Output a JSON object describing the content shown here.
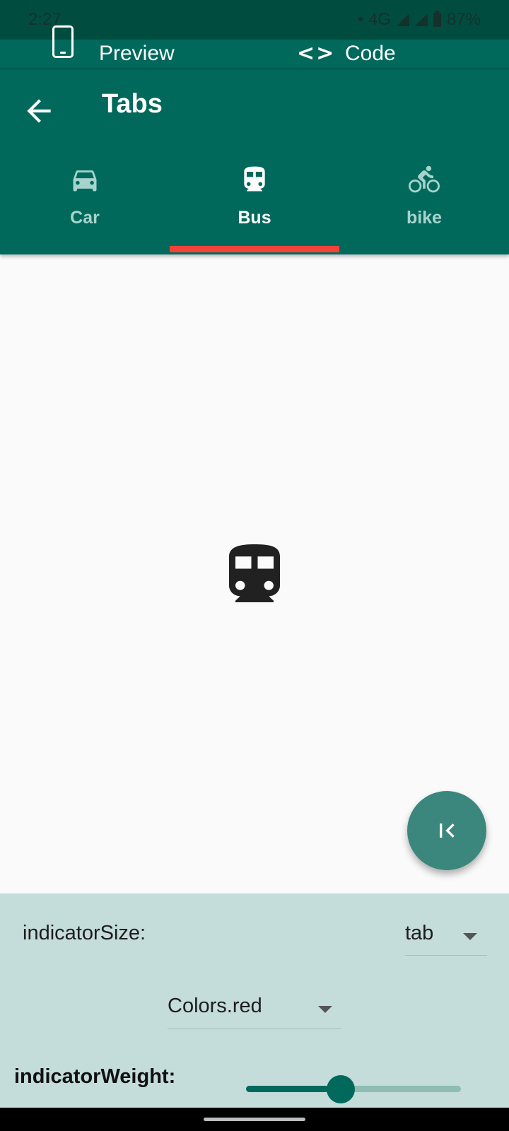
{
  "status_bar": {
    "time": "2:27",
    "network": "• 4G",
    "battery": "87%"
  },
  "top_toggle": {
    "preview_label": "Preview",
    "code_label": "Code",
    "preview_icon": "phone-icon",
    "code_icon": "code-brackets-icon"
  },
  "app_bar": {
    "title": "Tabs",
    "back_icon": "arrow-back-icon",
    "tabs": [
      {
        "label": "Car",
        "icon": "car-icon",
        "selected": false
      },
      {
        "label": "Bus",
        "icon": "bus-icon",
        "selected": true
      },
      {
        "label": "bike",
        "icon": "bike-icon",
        "selected": false
      }
    ],
    "indicator_color": "#f44336",
    "background_color": "#00695c"
  },
  "content": {
    "icon": "bus-icon"
  },
  "fab": {
    "icon": "first-page-icon"
  },
  "controls": {
    "indicator_size_label": "indicatorSize:",
    "indicator_size_value": "tab",
    "color_value": "Colors.red",
    "indicator_weight_label": "indicatorWeight:",
    "indicator_weight_fraction": 0.44
  }
}
